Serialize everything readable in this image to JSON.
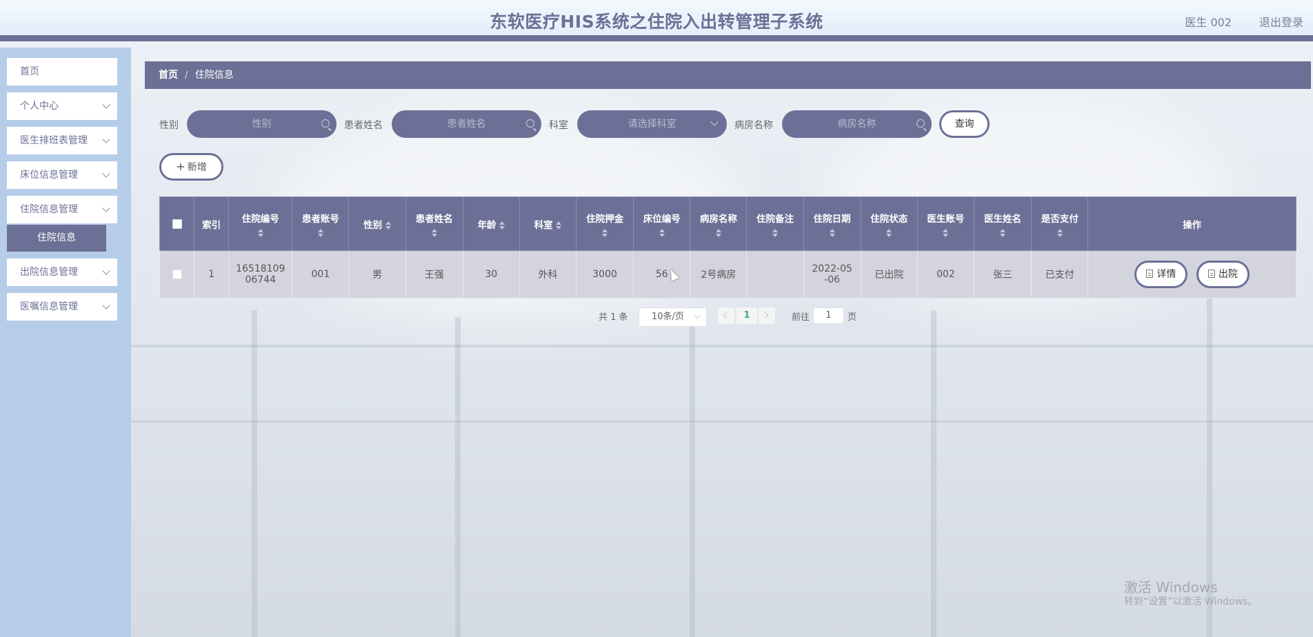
{
  "header": {
    "title": "东软医疗HIS系统之住院入出转管理子系统",
    "user": "医生 002",
    "logout": "退出登录"
  },
  "sidebar": {
    "items": [
      {
        "label": "首页",
        "has_chevron": false
      },
      {
        "label": "个人中心",
        "has_chevron": true
      },
      {
        "label": "医生排班表管理",
        "has_chevron": true
      },
      {
        "label": "床位信息管理",
        "has_chevron": true
      },
      {
        "label": "住院信息管理",
        "has_chevron": true
      },
      {
        "label": "出院信息管理",
        "has_chevron": true
      },
      {
        "label": "医嘱信息管理",
        "has_chevron": true
      }
    ],
    "active_sub": "住院信息"
  },
  "breadcrumb": {
    "home": "首页",
    "separator": "/",
    "current": "住院信息"
  },
  "search": {
    "gender_label": "性别",
    "gender_placeholder": "性别",
    "patient_name_label": "患者姓名",
    "patient_name_placeholder": "患者姓名",
    "department_label": "科室",
    "department_placeholder": "请选择科室",
    "ward_label": "病房名称",
    "ward_placeholder": "病房名称",
    "query_button": "查询"
  },
  "toolbar": {
    "add_button": "新增"
  },
  "table": {
    "columns": [
      "索引",
      "住院编号",
      "患者账号",
      "性别",
      "患者姓名",
      "年龄",
      "科室",
      "住院押金",
      "床位编号",
      "病房名称",
      "住院备注",
      "住院日期",
      "住院状态",
      "医生账号",
      "医生姓名",
      "是否支付",
      "操作"
    ],
    "rows": [
      {
        "index": "1",
        "admission_no_line1": "16518109",
        "admission_no_line2": "06744",
        "patient_account": "001",
        "gender": "男",
        "patient_name": "王强",
        "age": "30",
        "department": "外科",
        "deposit": "3000",
        "bed_no": "56",
        "ward_name": "2号病房",
        "remark": "",
        "date_line1": "2022-05",
        "date_line2": "-06",
        "status": "已出院",
        "doctor_account": "002",
        "doctor_name": "张三",
        "paid": "已支付",
        "detail_button": "详情",
        "discharge_button": "出院"
      }
    ]
  },
  "pagination": {
    "total": "共 1 条",
    "page_size": "10条/页",
    "current_page": "1",
    "goto_label": "前往",
    "goto_value": "1",
    "goto_unit": "页"
  },
  "watermark": {
    "line1": "激活 Windows",
    "line2": "转到“设置”以激活 Windows。"
  },
  "colors": {
    "accent": "#6c7096",
    "sidebar_bg": "#b6cde9",
    "row_bg": "#d3d4de",
    "page_active": "#37b06a"
  }
}
